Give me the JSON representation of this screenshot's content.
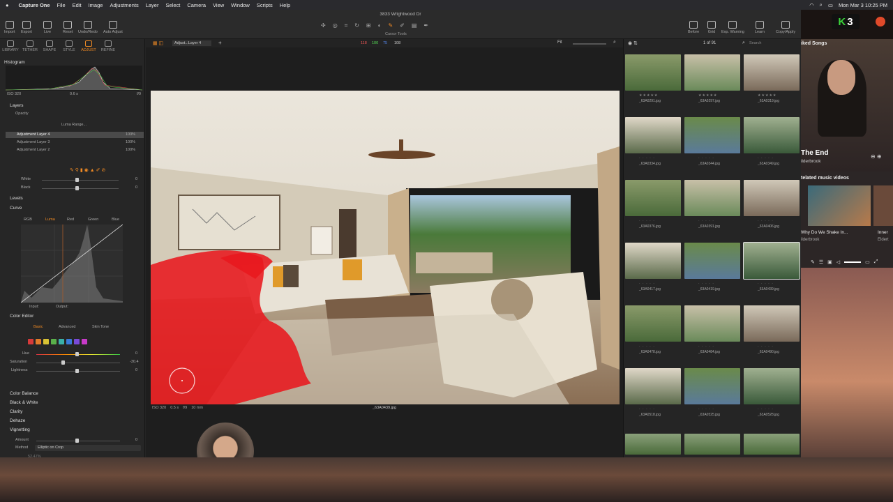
{
  "menubar": {
    "app": "Capture One",
    "items": [
      "File",
      "Edit",
      "Image",
      "Adjustments",
      "Layer",
      "Select",
      "Camera",
      "View",
      "Window",
      "Scripts",
      "Help"
    ],
    "clock": "Mon Mar 3  10:25 PM"
  },
  "window": {
    "title": "3833 Wrightwood Dr"
  },
  "toolbar": {
    "left": [
      "Import",
      "Export",
      "Live",
      "Reset",
      "Undo/Redo",
      "Auto Adjust"
    ],
    "center": "Cursor Tools",
    "right": [
      "Before",
      "Grid",
      "Exp. Warning",
      "Learn",
      "Copy/Apply"
    ]
  },
  "tool_tabs": [
    "LIBRARY",
    "TETHER",
    "SHAPE",
    "STYLE",
    "ADJUST",
    "REFINE"
  ],
  "histogram": {
    "title": "Histogram",
    "iso": "ISO 320",
    "shutter": "0.6 s",
    "aperture": "f/9"
  },
  "layers": {
    "title": "Layers",
    "opacity_label": "Opacity",
    "luma_range": "Luma Range...",
    "items": [
      {
        "name": "Adjustment Layer 4",
        "pct": "100%"
      },
      {
        "name": "Adjustment Layer 3",
        "pct": "100%"
      },
      {
        "name": "Adjustment Layer 2",
        "pct": "100%"
      }
    ]
  },
  "whites_blacks": {
    "white_label": "White",
    "white_val": "0",
    "black_label": "Black",
    "black_val": "0"
  },
  "levels": {
    "title": "Levels"
  },
  "curve": {
    "title": "Curve",
    "tabs": [
      "RGB",
      "Luma",
      "Red",
      "Green",
      "Blue"
    ],
    "input": "Input:",
    "output": "Output:"
  },
  "color_editor": {
    "title": "Color Editor",
    "tabs": [
      "Basic",
      "Advanced",
      "Skin Tone"
    ],
    "swatches": [
      "#d73a3a",
      "#e07b2a",
      "#d8c234",
      "#5ab04a",
      "#3ab0a8",
      "#3a7ad8",
      "#7a4ad8",
      "#c83ac8"
    ],
    "hue_label": "Hue",
    "hue_val": "0",
    "sat_label": "Saturation",
    "sat_val": "-30.4",
    "light_label": "Lightness",
    "light_val": "0"
  },
  "bottom_tools": [
    "Color Balance",
    "Black & White",
    "Clarity",
    "Dehaze",
    "Vignetting"
  ],
  "vignetting": {
    "amount_label": "Amount",
    "amount_val": "0",
    "method_label": "Method",
    "method_val": "Elliptic on Crop"
  },
  "footer": {
    "zoom": "52.47%"
  },
  "viewer": {
    "layer_select": "Adjust...Layer 4",
    "readout": {
      "r": "118",
      "g": "100",
      "b": "75",
      "l": "108"
    },
    "fit": "Fit",
    "iso": "ISO 320",
    "shutter": "0.5 s",
    "aperture": "f/9",
    "focal": "10 mm",
    "filename": "_63A0439.jpg"
  },
  "browser": {
    "count": "1 of 91",
    "search_placeholder": "Search",
    "rows": [
      [
        "_63A0291.jpg",
        "_63A0297.jpg",
        "_63A0319.jpg"
      ],
      [
        "_63A0334.jpg",
        "_63A0344.jpg",
        "_63A0349.jpg"
      ],
      [
        "_63A0376.jpg",
        "_63A0391.jpg",
        "_63A0406.jpg"
      ],
      [
        "_63A0417.jpg",
        "_63A0419.jpg",
        "_63A0439.jpg"
      ],
      [
        "_63A0478.jpg",
        "_63A0484.jpg",
        "_63A0490.jpg"
      ],
      [
        "_63A0518.jpg",
        "_63A0525.jpg",
        "_63A0528.jpg"
      ]
    ]
  },
  "music": {
    "header": "iked Songs",
    "song": "The End",
    "artist": "ilderbrook",
    "related": "telated music videos",
    "video1": "Why Do We Shake In...",
    "video1_artist": "ilderbrook",
    "video2": "Inner",
    "video2_artist": "Eldert"
  },
  "status_icons": {
    "k_count": "3"
  }
}
